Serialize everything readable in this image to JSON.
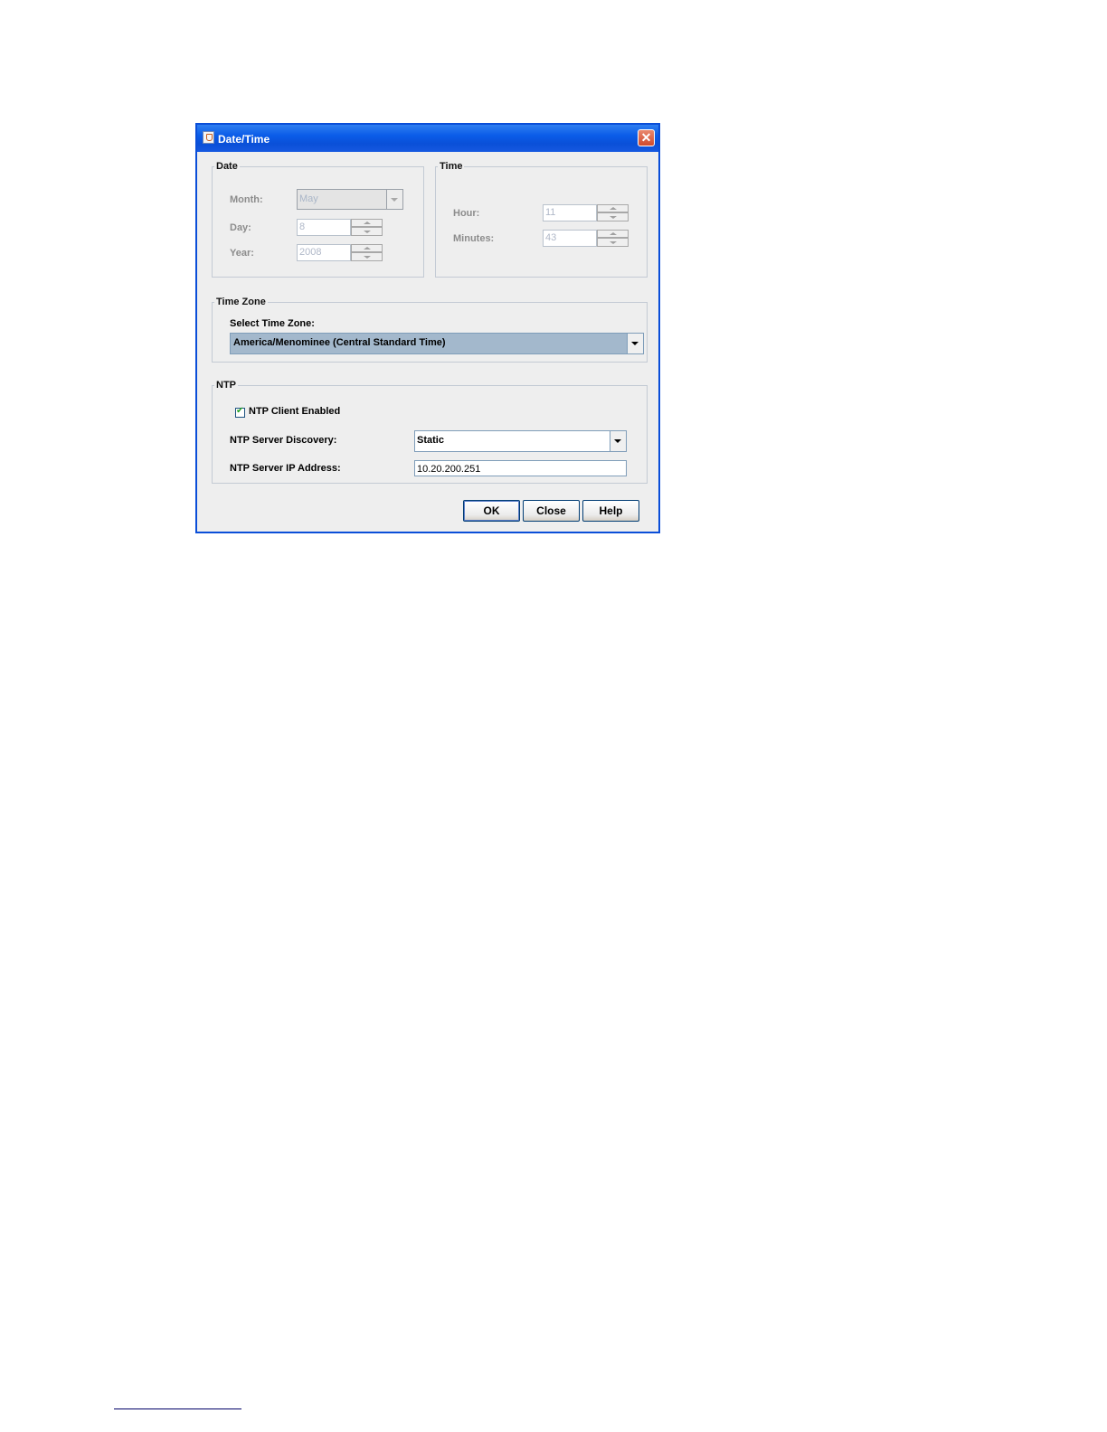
{
  "window": {
    "title": "Date/Time",
    "close_symbol": "✕"
  },
  "date": {
    "legend": "Date",
    "month_label": "Month:",
    "month_value": "May",
    "day_label": "Day:",
    "day_value": "8",
    "year_label": "Year:",
    "year_value": "2008"
  },
  "time": {
    "legend": "Time",
    "hour_label": "Hour:",
    "hour_value": "11",
    "minutes_label": "Minutes:",
    "minutes_value": "43"
  },
  "timezone": {
    "legend": "Time Zone",
    "select_label": "Select Time Zone:",
    "value": "America/Menominee (Central Standard Time)"
  },
  "ntp": {
    "legend": "NTP",
    "client_enabled_label": "NTP Client Enabled",
    "client_enabled": true,
    "discovery_label": "NTP Server Discovery:",
    "discovery_value": "Static",
    "ip_label": "NTP Server IP Address:",
    "ip_value": "10.20.200.251"
  },
  "buttons": {
    "ok": "OK",
    "close": "Close",
    "help": "Help"
  },
  "colors": {
    "titlebar": "#0a5ce8",
    "selected_combo": "#a3b8cc"
  }
}
